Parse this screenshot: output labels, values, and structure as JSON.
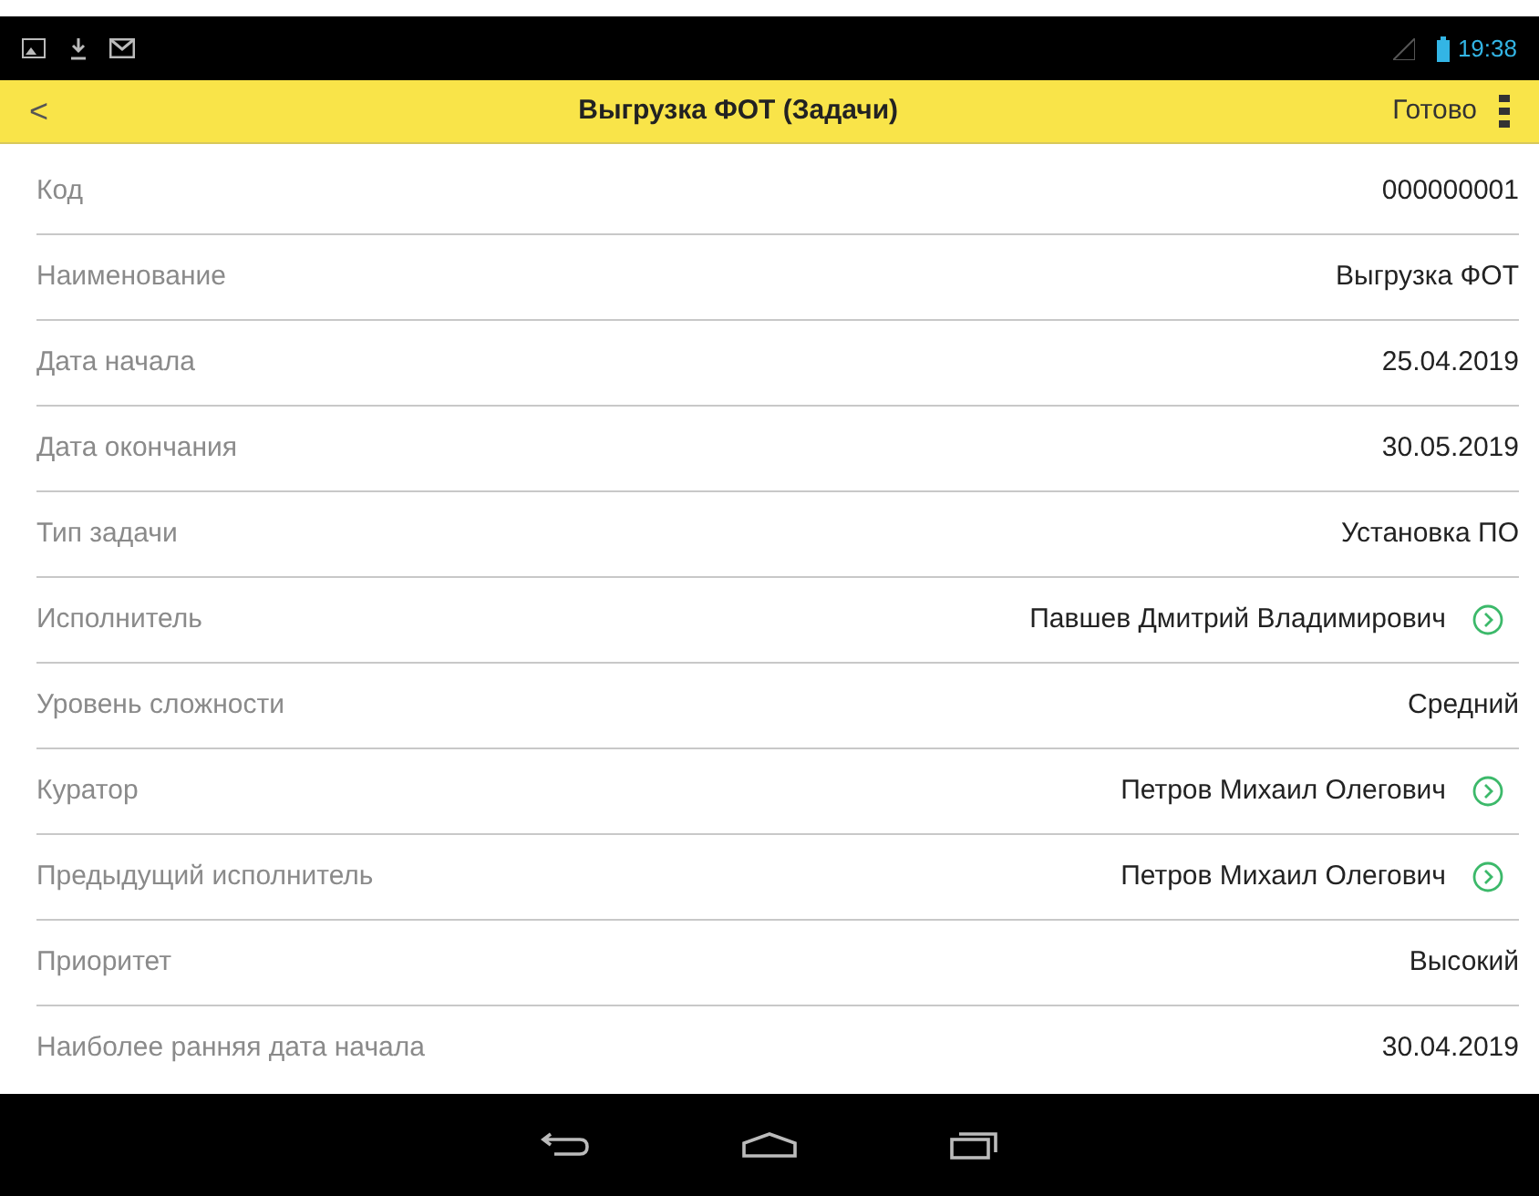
{
  "status_bar": {
    "time": "19:38"
  },
  "header": {
    "back": "<",
    "title": "Выгрузка ФОТ (Задачи)",
    "done": "Готово"
  },
  "fields": [
    {
      "label": "Код",
      "value": "000000001",
      "kind": "plain"
    },
    {
      "label": "Наименование",
      "value": "Выгрузка ФОТ",
      "kind": "plain"
    },
    {
      "label": "Дата начала",
      "value": "25.04.2019",
      "kind": "plain"
    },
    {
      "label": "Дата окончания",
      "value": "30.05.2019",
      "kind": "plain"
    },
    {
      "label": "Тип задачи",
      "value": "Установка ПО",
      "kind": "plain"
    },
    {
      "label": "Исполнитель",
      "value": "Павшев Дмитрий Владимирович",
      "kind": "link"
    },
    {
      "label": "Уровень сложности",
      "value": "Средний",
      "kind": "plain"
    },
    {
      "label": "Куратор",
      "value": "Петров Михаил Олегович",
      "kind": "link"
    },
    {
      "label": "Предыдущий исполнитель",
      "value": "Петров Михаил Олегович",
      "kind": "link"
    },
    {
      "label": "Приоритет",
      "value": "Высокий",
      "kind": "plain"
    },
    {
      "label": "Наиболее ранняя дата начала",
      "value": "30.04.2019",
      "kind": "plain"
    }
  ]
}
